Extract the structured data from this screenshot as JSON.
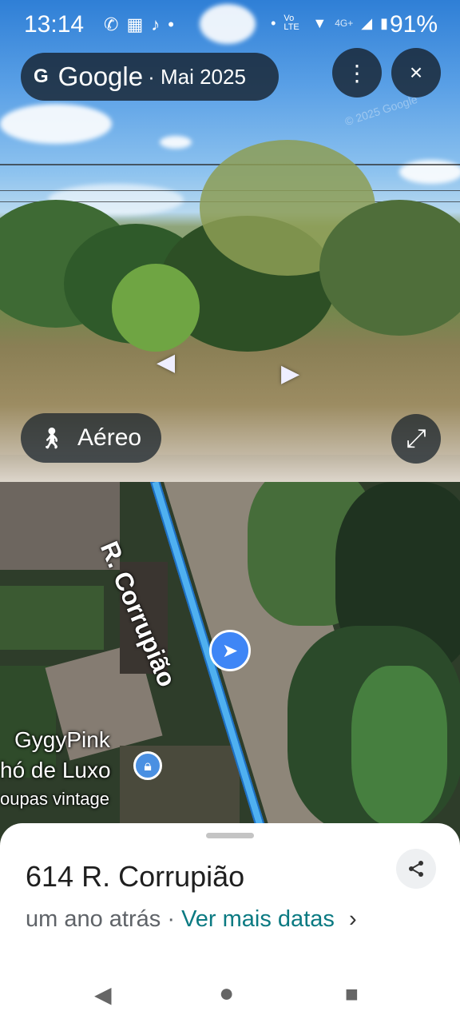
{
  "status_bar": {
    "time": "13:14",
    "network_label": "Vo LTE",
    "signal_label": "4G+",
    "battery": "91%"
  },
  "top_bar": {
    "g_letter": "G",
    "brand": "Google",
    "date": "· Mai 2025",
    "more_icon": "⋮",
    "close_icon": "×"
  },
  "panorama": {
    "copyright": "© 2025 Google",
    "aereo_label": "Aéreo",
    "expand_icon": "⤢"
  },
  "map": {
    "street_label": "R. Corrupião",
    "poi": {
      "line1": "GygyPink",
      "line2": "hó de Luxo",
      "line3": "oupas vintage"
    }
  },
  "sheet": {
    "address": "614 R. Corrupião",
    "age": "um ano atrás",
    "separator": "·",
    "link": "Ver mais datas",
    "chevron": "›",
    "share_icon": "share-icon"
  },
  "nav": {
    "back": "◀",
    "home": "●",
    "recents": "■"
  },
  "colors": {
    "chip_bg": "#14202A",
    "link": "#0B7A82",
    "route_blue": "#4FB0F0",
    "marker_blue": "#3F86F6"
  }
}
